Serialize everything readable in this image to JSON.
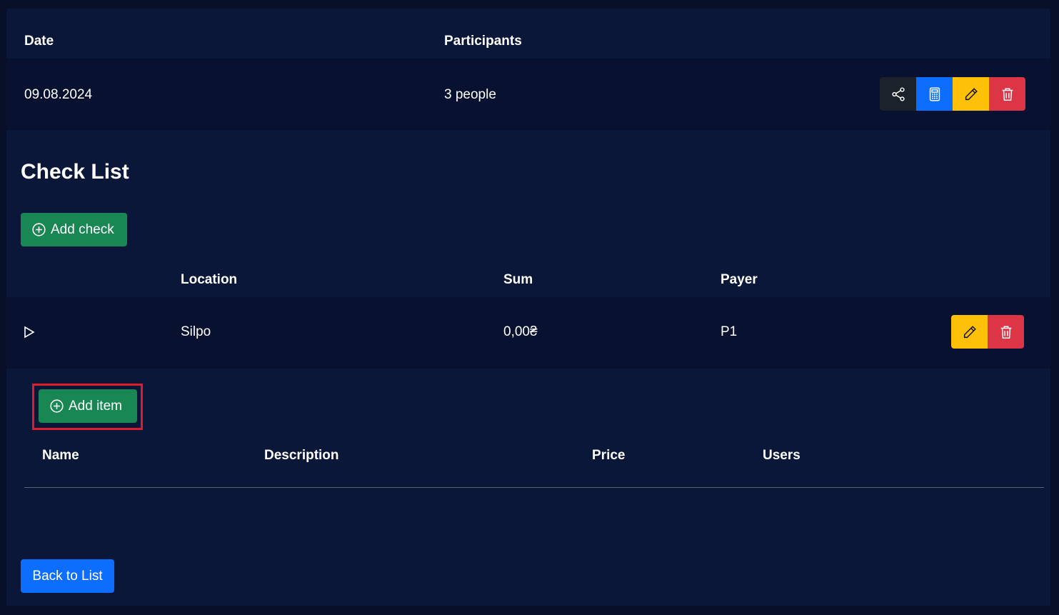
{
  "trip": {
    "headers": {
      "date": "Date",
      "participants": "Participants"
    },
    "row": {
      "date": "09.08.2024",
      "participants": "3 people"
    },
    "actions": [
      "share-icon",
      "calculator-icon",
      "pencil-icon",
      "trash-icon"
    ]
  },
  "check_list": {
    "title": "Check List",
    "add_check_label": "Add check",
    "headers": {
      "location": "Location",
      "sum": "Sum",
      "payer": "Payer"
    },
    "rows": [
      {
        "location": "Silpo",
        "sum": "0,00₴",
        "payer": "P1"
      }
    ],
    "row_actions": [
      "pencil-icon",
      "trash-icon"
    ]
  },
  "items": {
    "add_item_label": "Add item",
    "headers": {
      "name": "Name",
      "description": "Description",
      "price": "Price",
      "users": "Users"
    }
  },
  "footer": {
    "back_label": "Back to List"
  },
  "colors": {
    "page_bg": "#070f29",
    "panel_bg": "#0a1739",
    "row_bg": "#081130",
    "green": "#198754",
    "blue": "#0d6efd",
    "yellow": "#ffc107",
    "red": "#dc3545",
    "dark": "#1c222b",
    "highlight": "#e01b2c"
  }
}
